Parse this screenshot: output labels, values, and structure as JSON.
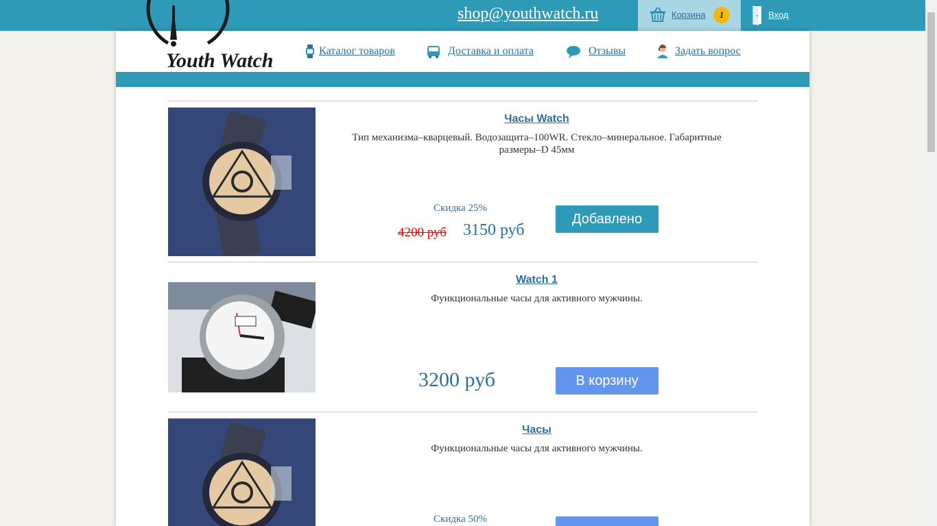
{
  "header": {
    "email": "shop@youthwatch.ru",
    "cart_label": "Корзина",
    "cart_count": "1",
    "login_label": "Вход"
  },
  "logo": {
    "text": "Youth Watch"
  },
  "nav": [
    {
      "label": "Каталог товаров",
      "icon": "watch-icon"
    },
    {
      "label": "Доставка и оплата",
      "icon": "bus-icon"
    },
    {
      "label": "Отзывы",
      "icon": "speech-bubble-icon"
    },
    {
      "label": "Задать вопрос",
      "icon": "support-agent-icon"
    }
  ],
  "products": [
    {
      "title": "Часы Watch",
      "description": "Тип механизма–кварцевый. Водозащита–100WR. Стекло–минеральное. Габаритные размеры–D 45мм",
      "discount": "Скидка 25%",
      "old_price": "4200 руб",
      "price": "3150 руб",
      "button": "Добавлено",
      "button_state": "added"
    },
    {
      "title": "Watch 1",
      "description": "Функциональные часы для активного мужчины.",
      "price": "3200 руб",
      "button": "В корзину",
      "button_state": "add"
    },
    {
      "title": "Часы",
      "description": "Функциональные часы для активного мужчины.",
      "discount": "Скидка 50%",
      "button_state": "add"
    }
  ],
  "colors": {
    "brand_teal": "#2e9ab8",
    "link_blue": "#2a6f9e",
    "added_button": "#2e9ab8",
    "add_button": "#6495ed",
    "badge": "#f5b800",
    "old_price": "#ee0000"
  }
}
